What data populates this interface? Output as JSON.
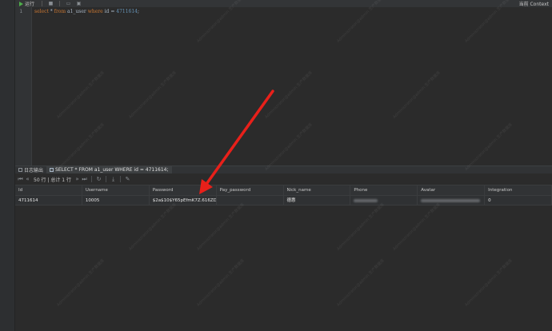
{
  "toolbar": {
    "run_label": "运行",
    "right_label": "当前 Context"
  },
  "editor": {
    "line_number": "1",
    "query": {
      "select": "select",
      "star": "*",
      "from": "from",
      "table": "a1_user",
      "where": "where",
      "col": "id",
      "eq": "=",
      "value": "4711614",
      "semi": ";"
    }
  },
  "tabs": [
    {
      "label": "日志输出"
    },
    {
      "label": "SELECT * FROM a1_user WHERE id = 4711614;"
    }
  ],
  "result_toolbar": {
    "rows_label": "50 行 | 总计 1 行"
  },
  "grid": {
    "columns": [
      "Id",
      "Username",
      "Password",
      "Pay_password",
      "Nick_name",
      "Phone",
      "Avatar",
      "Integration"
    ],
    "rows": [
      {
        "id": "4711614",
        "username": "10005",
        "password": "$2a$10$Y65pEfmK7Z.616ZDVR...",
        "pay_password": "",
        "nick_name": "德惠",
        "phone": "",
        "avatar": "https://...",
        "integration": "0"
      }
    ]
  },
  "watermark": {
    "line1": "Administrator@admin",
    "line2": "生产数据库"
  },
  "colors": {
    "accent_run": "#4fae4a",
    "arrow": "#e8201a"
  }
}
